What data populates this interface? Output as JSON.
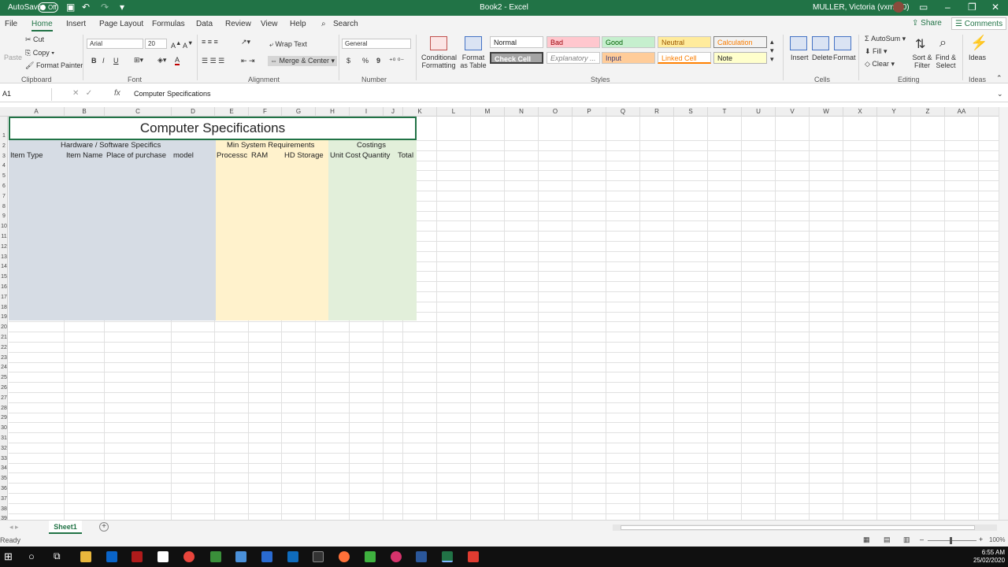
{
  "titlebar": {
    "autosave_label": "AutoSave",
    "autosave_state": "Off",
    "doc_title": "Book2 - Excel",
    "user": "MULLER, Victoria (vxmull0)"
  },
  "tabs": [
    "File",
    "Home",
    "Insert",
    "Page Layout",
    "Formulas",
    "Data",
    "Review",
    "View",
    "Help"
  ],
  "search_label": "Search",
  "share_label": "Share",
  "comments_label": "Comments",
  "ribbon": {
    "clipboard": {
      "paste": "Paste",
      "cut": "Cut",
      "copy": "Copy",
      "format_painter": "Format Painter",
      "label": "Clipboard"
    },
    "font": {
      "name": "Arial",
      "size": "20",
      "bold": "B",
      "italic": "I",
      "underline": "U",
      "label": "Font"
    },
    "alignment": {
      "wrap": "Wrap Text",
      "merge": "Merge & Center",
      "label": "Alignment"
    },
    "number": {
      "format": "General",
      "currency": "$",
      "percent": "%",
      "comma": "9",
      "label": "Number"
    },
    "styles": {
      "conditional": "Conditional Formatting",
      "format_table": "Format as Table",
      "normal": "Normal",
      "bad": "Bad",
      "good": "Good",
      "neutral": "Neutral",
      "calculation": "Calculation",
      "check_cell": "Check Cell",
      "explanatory": "Explanatory ...",
      "input": "Input",
      "linked_cell": "Linked Cell",
      "note": "Note",
      "label": "Styles"
    },
    "cells": {
      "insert": "Insert",
      "delete": "Delete",
      "format": "Format",
      "label": "Cells"
    },
    "editing": {
      "autosum": "AutoSum",
      "fill": "Fill",
      "clear": "Clear",
      "sort": "Sort & Filter",
      "find": "Find & Select",
      "label": "Editing"
    },
    "ideas": {
      "ideas": "Ideas",
      "label": "Ideas"
    }
  },
  "formula_bar": {
    "name_box": "A1",
    "fx": "fx",
    "content": "Computer Specifications"
  },
  "columns": [
    "A",
    "B",
    "C",
    "D",
    "E",
    "F",
    "G",
    "H",
    "I",
    "J",
    "K",
    "L",
    "M",
    "N",
    "O",
    "P",
    "Q",
    "R",
    "S",
    "T",
    "U",
    "V",
    "W",
    "X",
    "Y",
    "Z",
    "AA"
  ],
  "rows": [
    "1",
    "2",
    "3",
    "4",
    "5",
    "6",
    "7",
    "8",
    "9",
    "10",
    "11",
    "12",
    "13",
    "14",
    "15",
    "16",
    "17",
    "18",
    "19",
    "20",
    "21",
    "22",
    "23",
    "24",
    "25",
    "26",
    "27",
    "28",
    "29",
    "30",
    "31",
    "32",
    "33",
    "34",
    "35",
    "36",
    "37",
    "38",
    "39"
  ],
  "sheet": {
    "title": "Computer Specifications",
    "group_hardware": "Hardware / Software Specifics",
    "group_min": "Min System Requirements",
    "group_costings": "Costings",
    "h_item_type": "Item Type",
    "h_item_name": "Item Name",
    "h_place": "Place of purchase",
    "h_model": "model",
    "h_processor": "Processc",
    "h_ram": "RAM",
    "h_hd": "HD Storage",
    "h_unit_cost": "Unit Cost",
    "h_quantity": "Quantity",
    "h_total": "Total"
  },
  "sheet_tab": "Sheet1",
  "add_sheet": "+",
  "status": "Ready",
  "zoom": "100%",
  "clock": {
    "time": "6:55 AM",
    "date": "25/02/2020"
  },
  "colors": {
    "excel_green": "#217346",
    "fill_blue": "#d6dce4",
    "fill_yellow": "#fff2cc",
    "fill_green": "#e2efda"
  }
}
